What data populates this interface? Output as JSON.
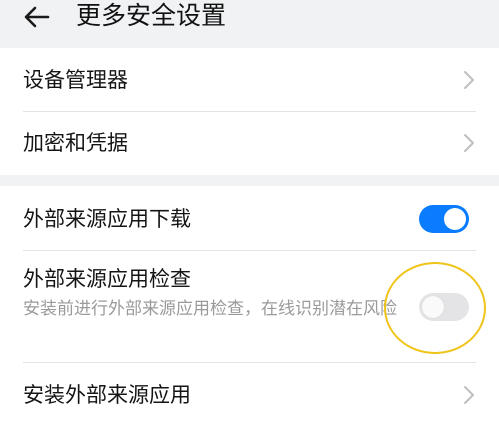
{
  "header": {
    "title": "更多安全设置",
    "back_icon": "back-arrow-icon"
  },
  "sections": [
    {
      "items": [
        {
          "label": "设备管理器",
          "control": "chevron"
        },
        {
          "label": "加密和凭据",
          "control": "chevron"
        }
      ]
    },
    {
      "items": [
        {
          "label": "外部来源应用下载",
          "control": "toggle",
          "toggle_on": true
        },
        {
          "label": "外部来源应用检查",
          "description": "安装前进行外部来源应用检查，在线识别潜在风险",
          "control": "toggle",
          "toggle_on": false
        },
        {
          "label": "安装外部来源应用",
          "control": "chevron"
        }
      ]
    }
  ],
  "colors": {
    "accent": "#0a7cff",
    "background": "#f1f2f4",
    "highlight": "#f0c419"
  }
}
